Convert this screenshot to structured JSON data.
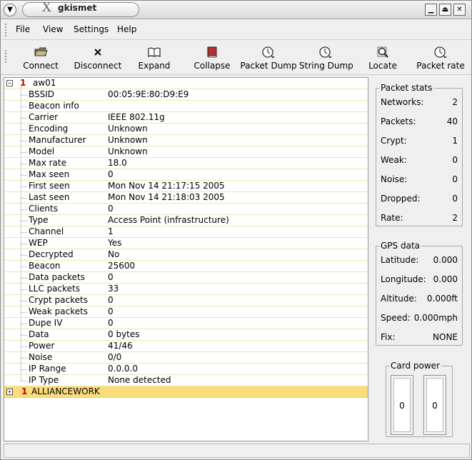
{
  "window": {
    "title": "gkismet"
  },
  "menu": {
    "items": [
      "File",
      "View",
      "Settings",
      "Help"
    ]
  },
  "toolbar": {
    "buttons": [
      {
        "label": "Connect",
        "icon": "folder-icon"
      },
      {
        "label": "Disconnect",
        "icon": "x-icon"
      },
      {
        "label": "Expand",
        "icon": "open-book-icon"
      },
      {
        "label": "Collapse",
        "icon": "closed-book-icon"
      },
      {
        "label": "Packet Dump",
        "icon": "stopwatch-icon"
      },
      {
        "label": "String Dump",
        "icon": "stopwatch-icon"
      },
      {
        "label": "Locate",
        "icon": "magnifier-icon"
      },
      {
        "label": "Packet rate",
        "icon": "stopwatch-icon"
      }
    ]
  },
  "tree": {
    "networks": [
      {
        "number": "1",
        "name": "aw01",
        "expanded": true,
        "fields": [
          {
            "key": "BSSID",
            "value": "00:05:9E:80:D9:E9"
          },
          {
            "key": "Beacon info",
            "value": ""
          },
          {
            "key": "Carrier",
            "value": "IEEE 802.11g"
          },
          {
            "key": "Encoding",
            "value": "Unknown"
          },
          {
            "key": "Manufacturer",
            "value": "Unknown"
          },
          {
            "key": "Model",
            "value": "Unknown"
          },
          {
            "key": "Max rate",
            "value": "18.0"
          },
          {
            "key": "Max seen",
            "value": "0"
          },
          {
            "key": "First seen",
            "value": "Mon Nov 14 21:17:15 2005"
          },
          {
            "key": "Last seen",
            "value": "Mon Nov 14 21:18:03 2005"
          },
          {
            "key": "Clients",
            "value": "0"
          },
          {
            "key": "Type",
            "value": "Access Point (infrastructure)"
          },
          {
            "key": "Channel",
            "value": "1"
          },
          {
            "key": "WEP",
            "value": "Yes"
          },
          {
            "key": "Decrypted",
            "value": "No"
          },
          {
            "key": "Beacon",
            "value": "25600"
          },
          {
            "key": "Data packets",
            "value": "0"
          },
          {
            "key": "LLC packets",
            "value": "33"
          },
          {
            "key": "Crypt packets",
            "value": "0"
          },
          {
            "key": "Weak packets",
            "value": "0"
          },
          {
            "key": "Dupe IV",
            "value": "0"
          },
          {
            "key": "Data",
            "value": "0 bytes"
          },
          {
            "key": "Power",
            "value": "41/46"
          },
          {
            "key": "Noise",
            "value": "0/0"
          },
          {
            "key": "IP Range",
            "value": "0.0.0.0"
          },
          {
            "key": "IP Type",
            "value": "None detected"
          }
        ]
      },
      {
        "number": "1",
        "name": "ALLIANCEWORK",
        "expanded": false,
        "selected": true,
        "fields": []
      }
    ]
  },
  "packet_stats": {
    "title": "Packet stats",
    "rows": [
      {
        "key": "Networks:",
        "value": "2"
      },
      {
        "key": "Packets:",
        "value": "40"
      },
      {
        "key": "Crypt:",
        "value": "1"
      },
      {
        "key": "Weak:",
        "value": "0"
      },
      {
        "key": "Noise:",
        "value": "0"
      },
      {
        "key": "Dropped:",
        "value": "0"
      },
      {
        "key": "Rate:",
        "value": "2"
      }
    ]
  },
  "gps_data": {
    "title": "GPS data",
    "rows": [
      {
        "key": "Latitude:",
        "value": "0.000"
      },
      {
        "key": "Longitude:",
        "value": "0.000"
      },
      {
        "key": "Altitude:",
        "value": "0.000ft"
      },
      {
        "key": "Speed:",
        "value": "0.000mph"
      },
      {
        "key": "Fix:",
        "value": "NONE"
      }
    ]
  },
  "card_power": {
    "title": "Card power",
    "values": [
      "0",
      "0"
    ]
  },
  "colors": {
    "selection": "#fadc7d",
    "network_number": "#c00000"
  }
}
